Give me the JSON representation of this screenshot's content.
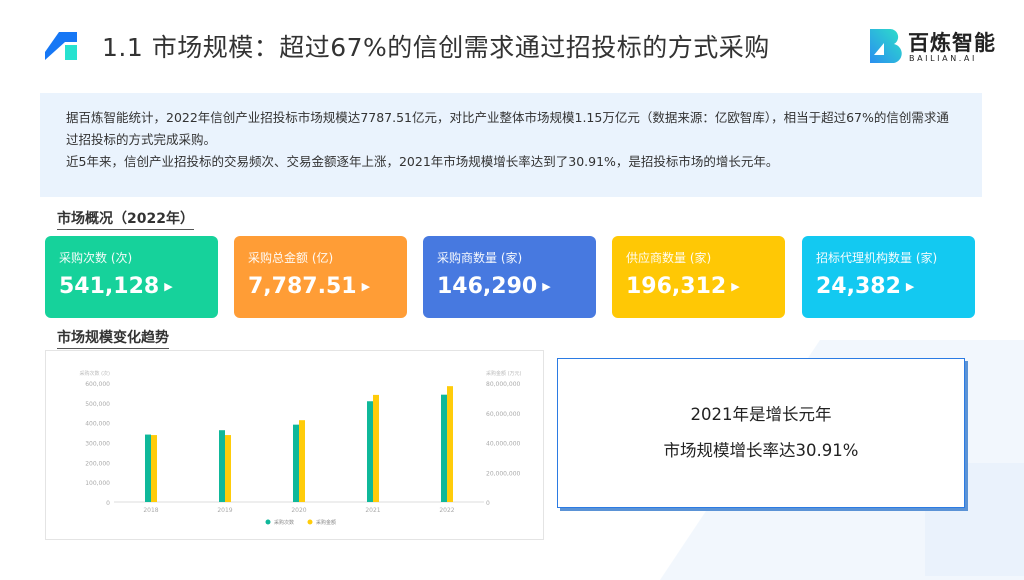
{
  "header": {
    "title": "1.1 市场规模：超过67%的信创需求通过招投标的方式采购",
    "brand_name": "百炼智能",
    "brand_sub": "BAILIAN.AI"
  },
  "info": {
    "paragraph1": "据百炼智能统计，2022年信创产业招投标市场规模达7787.51亿元，对比产业整体市场规模1.15万亿元（数据来源：亿欧智库），相当于超过67%的信创需求通过招投标的方式完成采购。",
    "paragraph2": "近5年来，信创产业招投标的交易频次、交易金额逐年上涨，2021年市场规模增长率达到了30.91%，是招投标市场的增长元年。"
  },
  "overview": {
    "title": "市场概况（2022年）",
    "cards": [
      {
        "label": "采购次数 (次)",
        "value": "541,128",
        "color": "#16d29b"
      },
      {
        "label": "采购总金额 (亿)",
        "value": "7,787.51",
        "color": "#ff9d36"
      },
      {
        "label": "采购商数量 (家)",
        "value": "146,290",
        "color": "#4779e0"
      },
      {
        "label": "供应商数量 (家)",
        "value": "196,312",
        "color": "#ffc805"
      },
      {
        "label": "招标代理机构数量 (家)",
        "value": "24,382",
        "color": "#13c9f1"
      }
    ]
  },
  "trend_title": "市场规模变化趋势",
  "callout": {
    "line1": "2021年是增长元年",
    "line2": "市场规模增长率达30.91%"
  },
  "chart_data": {
    "type": "bar",
    "categories": [
      "2018",
      "2019",
      "2020",
      "2021",
      "2022"
    ],
    "y_left": {
      "label": "采购次数 (次)",
      "range": [
        0,
        600000
      ],
      "ticks": [
        "0",
        "100,000",
        "200,000",
        "300,000",
        "400,000",
        "500,000",
        "600,000"
      ]
    },
    "y_right": {
      "label": "采购金额 (万元)",
      "range": [
        0,
        80000000
      ],
      "ticks": [
        "0",
        "20,000,000",
        "40,000,000",
        "60,000,000",
        "80,000,000"
      ]
    },
    "series": [
      {
        "name": "采购次数",
        "axis": "left",
        "color": "#0fb89a",
        "values": [
          340000,
          362000,
          390000,
          508000,
          541128
        ]
      },
      {
        "name": "采购金额",
        "axis": "right",
        "color": "#ffcc0a",
        "values": [
          45000000,
          45000000,
          55000000,
          72000000,
          77875100
        ]
      }
    ],
    "legend": "bottom"
  }
}
